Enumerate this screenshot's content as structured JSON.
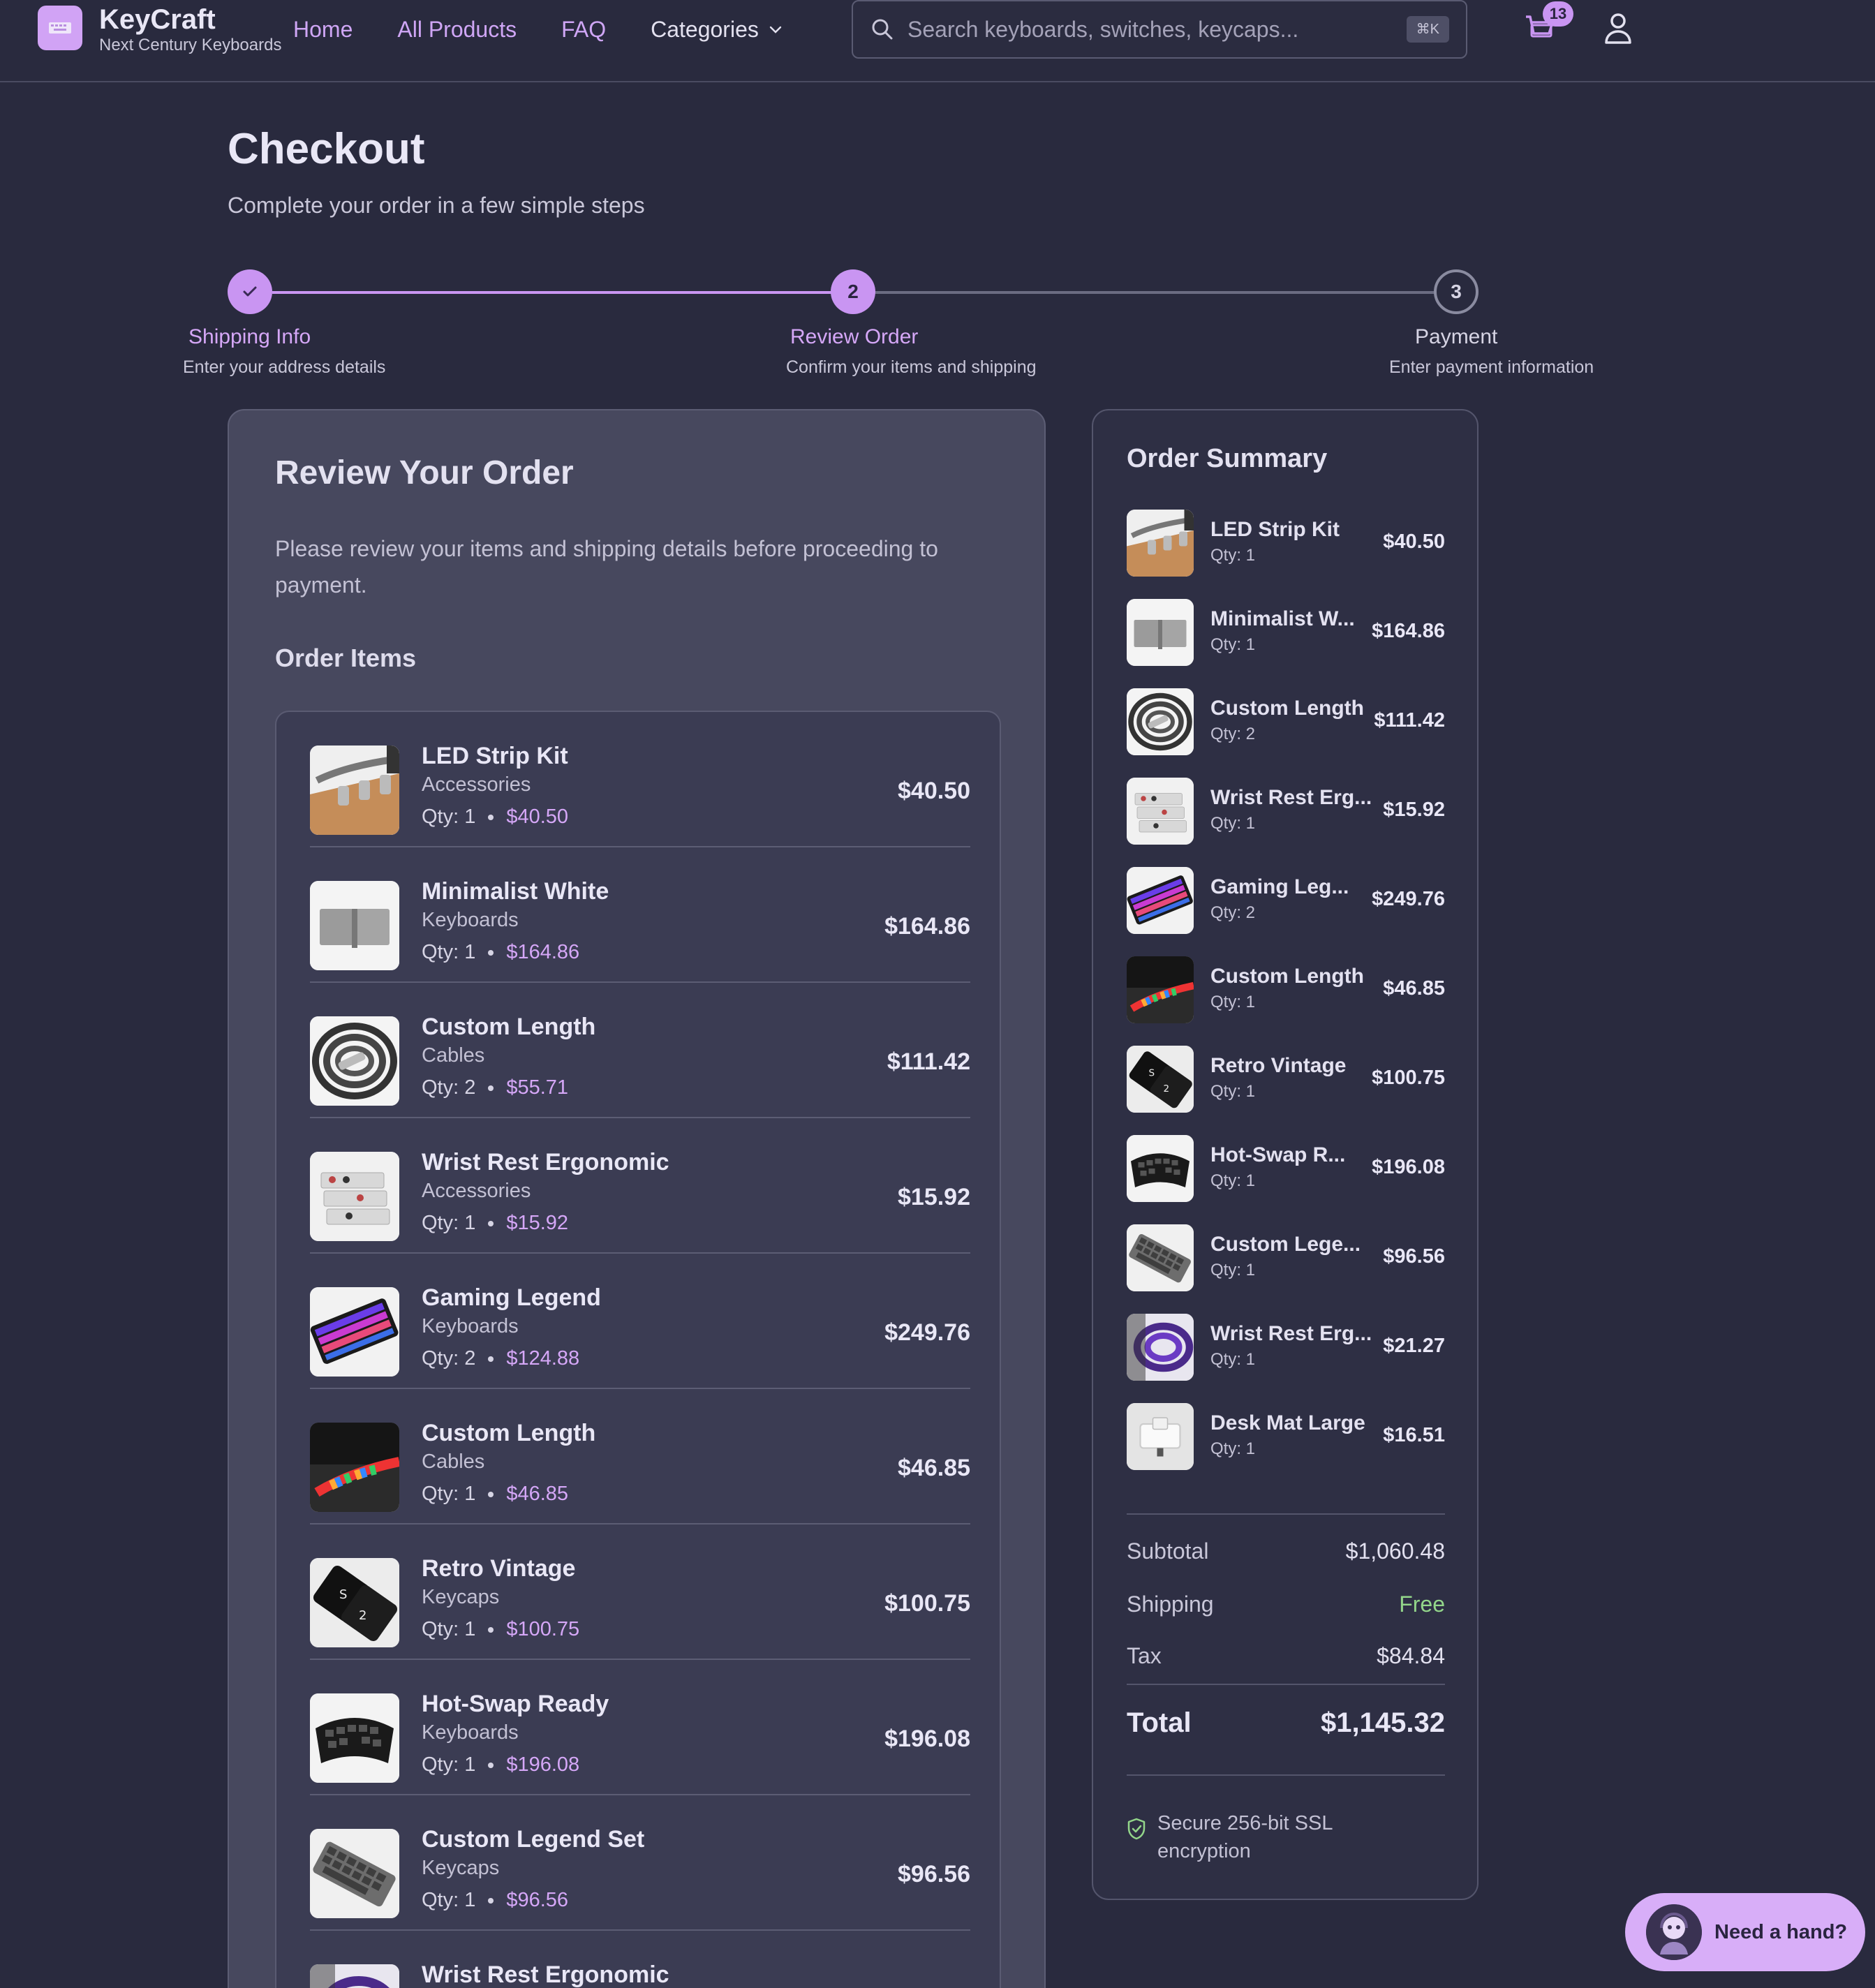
{
  "brand": {
    "name": "KeyCraft",
    "tagline": "Next Century Keyboards"
  },
  "nav": {
    "home": "Home",
    "all_products": "All Products",
    "faq": "FAQ",
    "categories": "Categories"
  },
  "search": {
    "placeholder": "Search keyboards, switches, keycaps...",
    "shortcut": "⌘K"
  },
  "cart": {
    "count": "13"
  },
  "page": {
    "title": "Checkout",
    "subtitle": "Complete your order in a few simple steps"
  },
  "steps": [
    {
      "number": "1",
      "label": "Shipping Info",
      "desc": "Enter your address details",
      "state": "done"
    },
    {
      "number": "2",
      "label": "Review Order",
      "desc": "Confirm your items and shipping",
      "state": "current"
    },
    {
      "number": "3",
      "label": "Payment",
      "desc": "Enter payment information",
      "state": "upcoming"
    }
  ],
  "review": {
    "title": "Review Your Order",
    "desc": "Please review your items and shipping details before proceeding to payment.",
    "items_heading": "Order Items",
    "items": [
      {
        "name": "LED Strip Kit",
        "category": "Accessories",
        "qty_text": "Qty: 1",
        "unit_price": "$40.50",
        "total": "$40.50",
        "thumb": "wood-cable-icon"
      },
      {
        "name": "Minimalist White",
        "category": "Keyboards",
        "qty_text": "Qty: 1",
        "unit_price": "$164.86",
        "total": "$164.86",
        "thumb": "white-board-icon"
      },
      {
        "name": "Custom Length",
        "category": "Cables",
        "qty_text": "Qty: 2",
        "unit_price": "$55.71",
        "total": "$111.42",
        "thumb": "coiled-cable-icon"
      },
      {
        "name": "Wrist Rest Ergonomic",
        "category": "Accessories",
        "qty_text": "Qty: 1",
        "unit_price": "$15.92",
        "total": "$15.92",
        "thumb": "switch-tray-icon"
      },
      {
        "name": "Gaming Legend",
        "category": "Keyboards",
        "qty_text": "Qty: 2",
        "unit_price": "$124.88",
        "total": "$249.76",
        "thumb": "rgb-keyboard-icon"
      },
      {
        "name": "Custom Length",
        "category": "Cables",
        "qty_text": "Qty: 1",
        "unit_price": "$46.85",
        "total": "$46.85",
        "thumb": "rainbow-cable-icon"
      },
      {
        "name": "Retro Vintage",
        "category": "Keycaps",
        "qty_text": "Qty: 1",
        "unit_price": "$100.75",
        "total": "$100.75",
        "thumb": "black-keycap-icon"
      },
      {
        "name": "Hot-Swap Ready",
        "category": "Keyboards",
        "qty_text": "Qty: 1",
        "unit_price": "$196.08",
        "total": "$196.08",
        "thumb": "split-keyboard-icon"
      },
      {
        "name": "Custom Legend Set",
        "category": "Keycaps",
        "qty_text": "Qty: 1",
        "unit_price": "$96.56",
        "total": "$96.56",
        "thumb": "grey-keyboard-icon"
      },
      {
        "name": "Wrist Rest Ergonomic",
        "category": "",
        "qty_text": "",
        "unit_price": "",
        "total": "",
        "thumb": "purple-cable-icon"
      }
    ]
  },
  "summary": {
    "title": "Order Summary",
    "items": [
      {
        "name": "LED Strip Kit",
        "qty": "Qty: 1",
        "price": "$40.50",
        "thumb": "wood-cable-icon"
      },
      {
        "name": "Minimalist W...",
        "qty": "Qty: 1",
        "price": "$164.86",
        "thumb": "white-board-icon"
      },
      {
        "name": "Custom Length",
        "qty": "Qty: 2",
        "price": "$111.42",
        "thumb": "coiled-cable-icon"
      },
      {
        "name": "Wrist Rest Erg...",
        "qty": "Qty: 1",
        "price": "$15.92",
        "thumb": "switch-tray-icon"
      },
      {
        "name": "Gaming Leg...",
        "qty": "Qty: 2",
        "price": "$249.76",
        "thumb": "rgb-keyboard-icon"
      },
      {
        "name": "Custom Length",
        "qty": "Qty: 1",
        "price": "$46.85",
        "thumb": "rainbow-cable-icon"
      },
      {
        "name": "Retro Vintage",
        "qty": "Qty: 1",
        "price": "$100.75",
        "thumb": "black-keycap-icon"
      },
      {
        "name": "Hot-Swap R...",
        "qty": "Qty: 1",
        "price": "$196.08",
        "thumb": "split-keyboard-icon"
      },
      {
        "name": "Custom Lege...",
        "qty": "Qty: 1",
        "price": "$96.56",
        "thumb": "grey-keyboard-icon"
      },
      {
        "name": "Wrist Rest Erg...",
        "qty": "Qty: 1",
        "price": "$21.27",
        "thumb": "purple-cable-icon"
      },
      {
        "name": "Desk Mat Large",
        "qty": "Qty: 1",
        "price": "$16.51",
        "thumb": "switch-tester-icon"
      }
    ],
    "subtotal_label": "Subtotal",
    "subtotal": "$1,060.48",
    "shipping_label": "Shipping",
    "shipping": "Free",
    "tax_label": "Tax",
    "tax": "$84.84",
    "total_label": "Total",
    "total": "$1,145.32",
    "secure": "Secure 256-bit SSL encryption"
  },
  "help": {
    "label": "Need a hand?"
  },
  "colors": {
    "background": "#292a3e",
    "accent": "#c995f2",
    "panel": "#47485e",
    "free": "#93d68a"
  }
}
